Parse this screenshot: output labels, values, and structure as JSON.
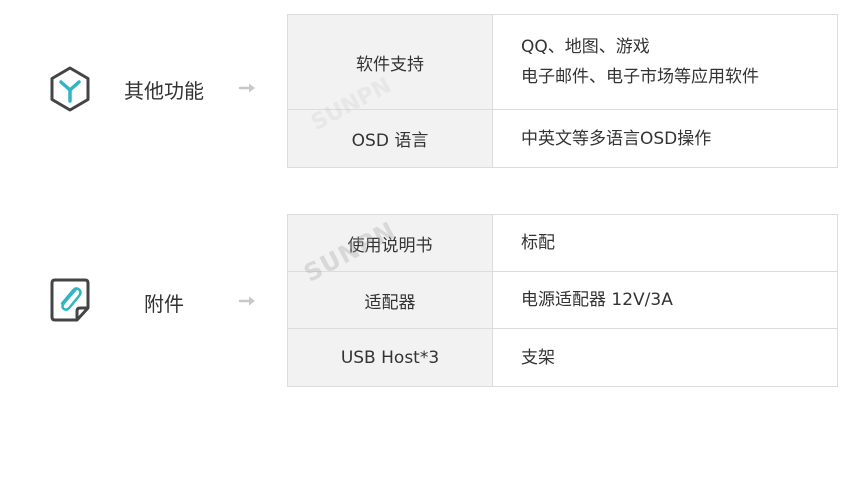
{
  "colors": {
    "icon_teal": "#2fb5c6",
    "icon_border": "#444444",
    "key_bg": "#f2f2f2",
    "border": "#dcdcdc"
  },
  "sections": [
    {
      "category": "其他功能",
      "icon": "cube-icon",
      "rows": [
        {
          "key": "软件支持",
          "value_lines": [
            "QQ、地图、游戏",
            "电子邮件、电子市场等应用软件"
          ]
        },
        {
          "key": "OSD 语言",
          "value_lines": [
            "中英文等多语言OSD操作"
          ]
        }
      ]
    },
    {
      "category": "附件",
      "icon": "paperclip-document-icon",
      "rows": [
        {
          "key": "使用说明书",
          "value_lines": [
            "标配"
          ]
        },
        {
          "key": "适配器",
          "value_lines": [
            "电源适配器 12V/3A"
          ]
        },
        {
          "key": "USB Host*3",
          "value_lines": [
            "支架"
          ]
        }
      ]
    }
  ],
  "watermark": "SUNPN"
}
